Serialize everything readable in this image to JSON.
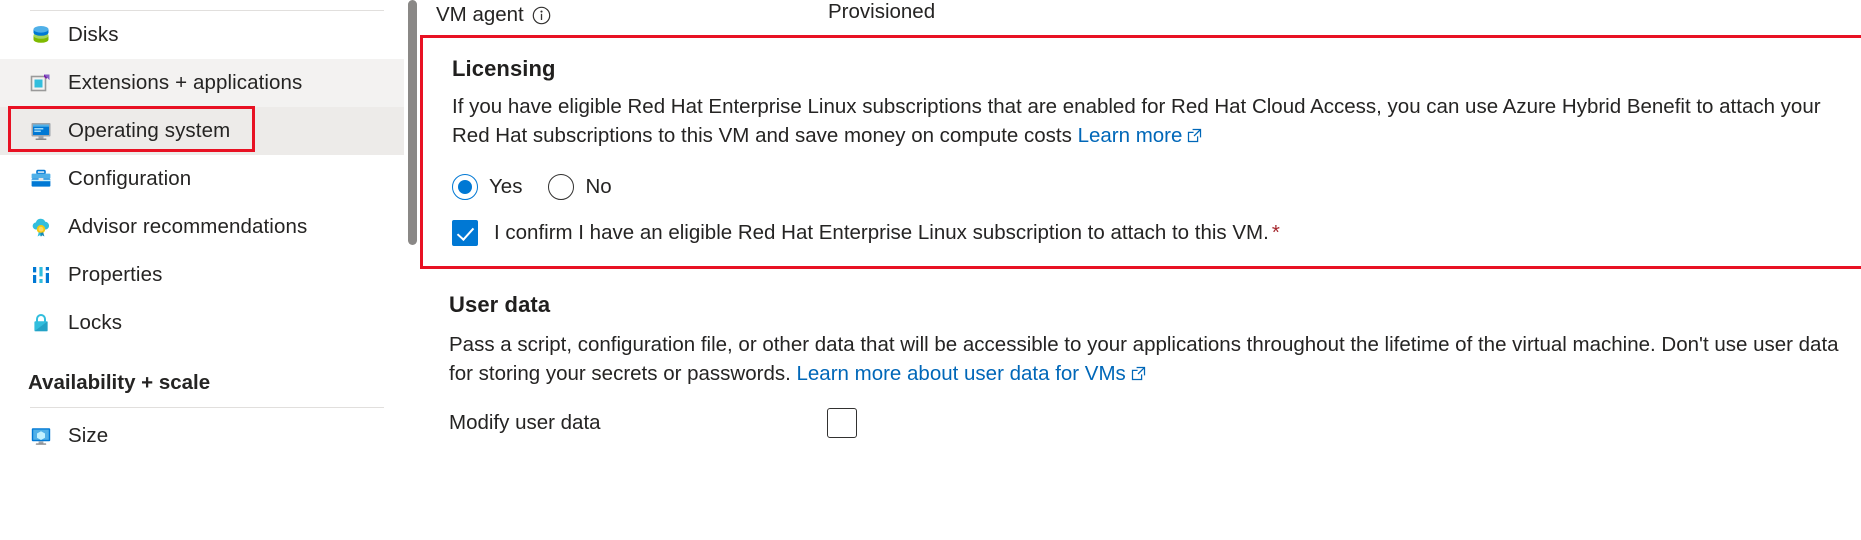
{
  "sidebar": {
    "items": [
      {
        "label": "Disks",
        "icon": "disks-icon",
        "state": "normal"
      },
      {
        "label": "Extensions + applications",
        "icon": "extensions-icon",
        "state": "hovered"
      },
      {
        "label": "Operating system",
        "icon": "operating-system-icon",
        "state": "selected"
      },
      {
        "label": "Configuration",
        "icon": "configuration-icon",
        "state": "normal"
      },
      {
        "label": "Advisor recommendations",
        "icon": "advisor-icon",
        "state": "normal"
      },
      {
        "label": "Properties",
        "icon": "properties-icon",
        "state": "normal"
      },
      {
        "label": "Locks",
        "icon": "locks-icon",
        "state": "normal"
      }
    ],
    "group_header": "Availability + scale",
    "group_items": [
      {
        "label": "Size",
        "icon": "size-icon",
        "state": "normal"
      }
    ],
    "highlight_color": "#e81123"
  },
  "content": {
    "vm_agent": {
      "label": "VM agent",
      "info_icon": "info-icon",
      "value": "Provisioned"
    },
    "licensing": {
      "title": "Licensing",
      "description_part1": "If you have eligible Red Hat Enterprise Linux subscriptions that are enabled for Red Hat Cloud Access, you can use Azure Hybrid Benefit to attach your Red Hat subscriptions to this VM and save money on compute costs",
      "learn_more": "Learn more",
      "radio_yes": "Yes",
      "radio_no": "No",
      "selected_radio": "Yes",
      "confirm_label": "I confirm I have an eligible Red Hat Enterprise Linux subscription to attach to this VM.",
      "confirm_required_marker": "*",
      "confirm_checked": true,
      "highlight_color": "#e81123"
    },
    "user_data": {
      "title": "User data",
      "description_part1": "Pass a script, configuration file, or other data that will be accessible to your applications throughout the lifetime of the virtual machine. Don't use user data for storing your secrets or passwords.",
      "learn_more": "Learn more about user data for VMs",
      "modify_label": "Modify user data",
      "modify_checked": false
    }
  },
  "colors": {
    "accent": "#0078d4",
    "link": "#0067b8",
    "highlight": "#e81123",
    "text": "#252423",
    "selected_bg": "#edebe9",
    "hover_bg": "#f3f2f1"
  }
}
